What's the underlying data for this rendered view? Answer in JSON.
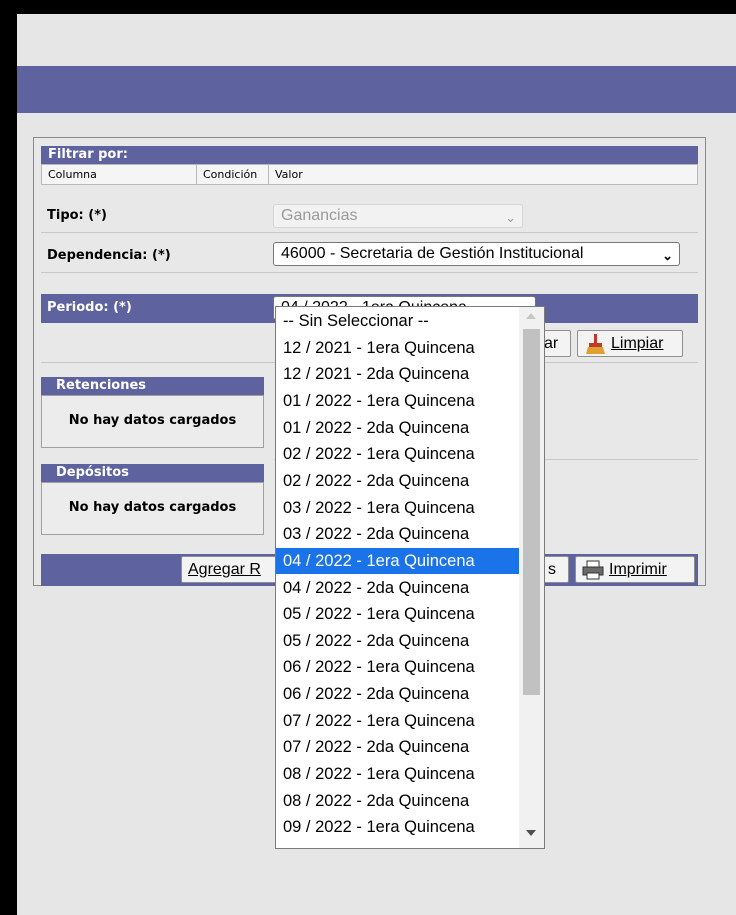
{
  "filter": {
    "title": "Filtrar por:",
    "columns": {
      "col1": "Columna",
      "col2": "Condición",
      "col3": "Valor"
    }
  },
  "fields": {
    "tipo": {
      "label": "Tipo: (*)",
      "value": "Ganancias"
    },
    "dependencia": {
      "label": "Dependencia: (*)",
      "value": "46000 - Secretaria de Gestión Institucional"
    },
    "periodo": {
      "label": "Periodo: (*)",
      "value": "04 / 2022 - 1era Quincena"
    }
  },
  "buttons": {
    "buscar_partial": "ar",
    "limpiar": "Limpiar",
    "agregar_partial": "Agregar R",
    "otros_partial": "s",
    "imprimir": "Imprimir"
  },
  "sections": {
    "retenciones": {
      "title": "Retenciones",
      "empty": "No hay datos cargados"
    },
    "depositos": {
      "title": "Depósitos",
      "empty": "No hay datos cargados"
    }
  },
  "dropdown": {
    "selected_index": 9,
    "options": [
      "-- Sin Seleccionar --",
      "12 / 2021 - 1era Quincena",
      "12 / 2021 - 2da Quincena",
      "01 / 2022 - 1era Quincena",
      "01 / 2022 - 2da Quincena",
      "02 / 2022 - 1era Quincena",
      "02 / 2022 - 2da Quincena",
      "03 / 2022 - 1era Quincena",
      "03 / 2022 - 2da Quincena",
      "04 / 2022 - 1era Quincena",
      "04 / 2022 - 2da Quincena",
      "05 / 2022 - 1era Quincena",
      "05 / 2022 - 2da Quincena",
      "06 / 2022 - 1era Quincena",
      "06 / 2022 - 2da Quincena",
      "07 / 2022 - 1era Quincena",
      "07 / 2022 - 2da Quincena",
      "08 / 2022 - 1era Quincena",
      "08 / 2022 - 2da Quincena",
      "09 / 2022 - 1era Quincena"
    ]
  },
  "colors": {
    "header": "#5e63a0",
    "selection": "#1a73e8"
  }
}
